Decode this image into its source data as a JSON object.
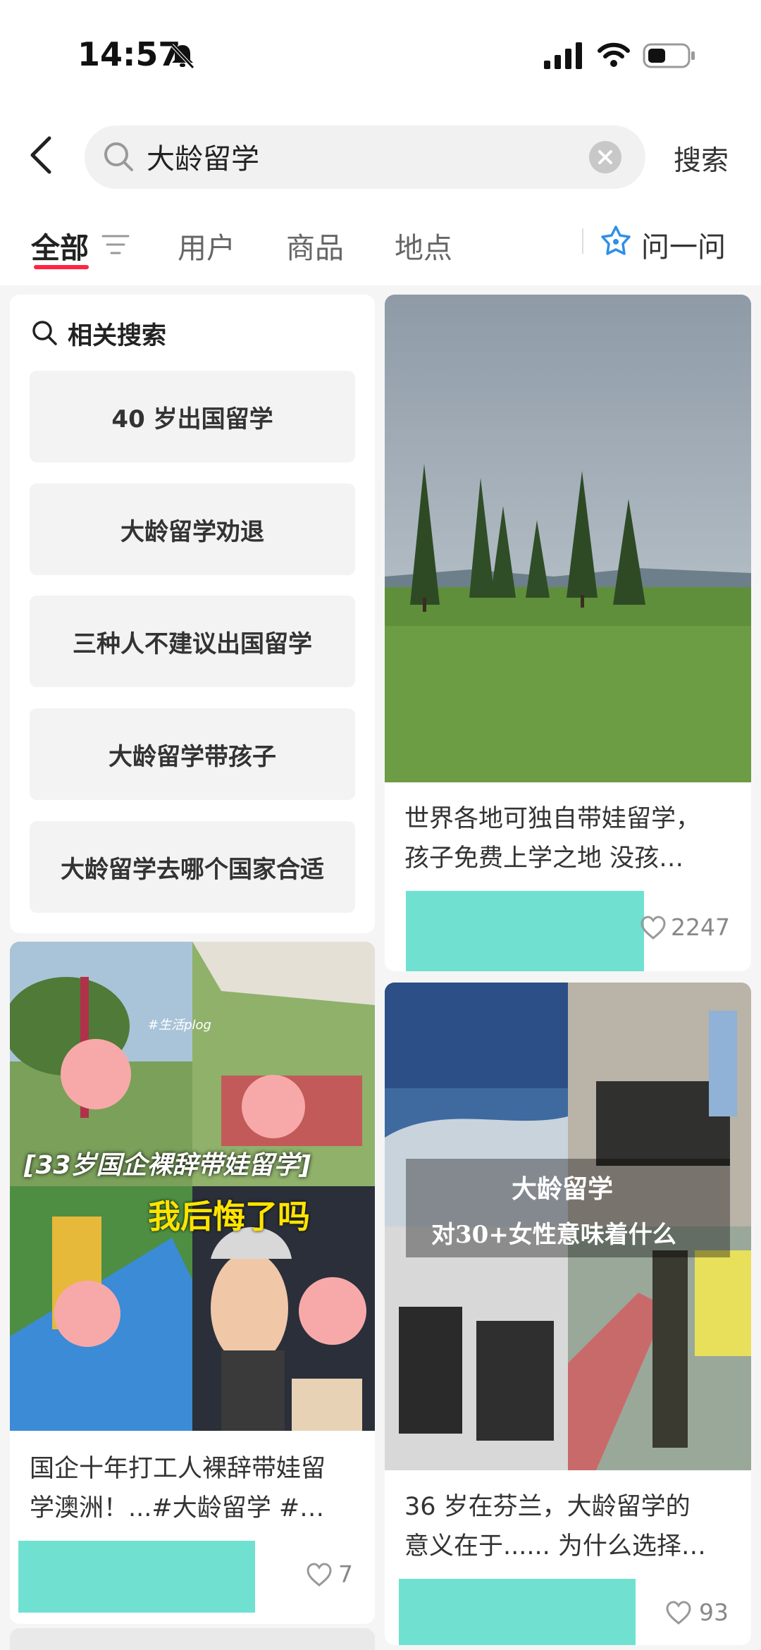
{
  "status_bar": {
    "time": "14:57"
  },
  "search": {
    "query": "大龄留学",
    "search_button": "搜索"
  },
  "tabs": [
    {
      "label": "全部",
      "active": true
    },
    {
      "label": "用户"
    },
    {
      "label": "商品"
    },
    {
      "label": "地点"
    }
  ],
  "ask": {
    "label": "问一问"
  },
  "related": {
    "title": "相关搜索",
    "items": [
      "40 岁出国留学",
      "大龄留学劝退",
      "三种人不建议出国留学",
      "大龄留学带孩子",
      "大龄留学去哪个国家合适"
    ]
  },
  "posts": [
    {
      "title_line1": "世界各地可独自带娃留学，",
      "title_line2": "孩子免费上学之地 没孩…",
      "likes": "2247"
    },
    {
      "image_text_top": "[33岁国企裸辞带娃留学]",
      "image_text_mid": "我后悔了吗",
      "image_tag": "#生活plog",
      "title_line1": "国企十年打工人裸辞带娃留",
      "title_line2": "学澳洲！...#大龄留学 #…",
      "likes": "7"
    },
    {
      "image_text_top": "大龄留学",
      "image_text_mid": "对30+女性意味着什么",
      "title_line1": "36 岁在芬兰，大龄留学的",
      "title_line2": "意义在于...... 为什么选择…",
      "likes": "93"
    }
  ],
  "colors": {
    "accent": "#ff2442",
    "redaction": "#70e1d0",
    "avatar_blur": "#f7a9a9"
  }
}
